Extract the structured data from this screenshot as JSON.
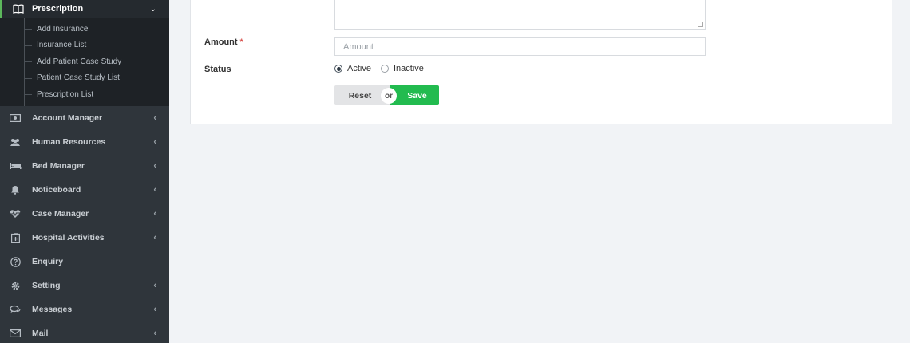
{
  "sidebar": {
    "open_menu": {
      "label": "Prescription",
      "icon": "book-icon"
    },
    "submenu": [
      "Add Insurance",
      "Insurance List",
      "Add Patient Case Study",
      "Patient Case Study List",
      "Prescription List"
    ],
    "items": [
      {
        "label": "Account Manager",
        "icon": "money-icon",
        "has_arrow": true
      },
      {
        "label": "Human Resources",
        "icon": "users-icon",
        "has_arrow": true
      },
      {
        "label": "Bed Manager",
        "icon": "bed-icon",
        "has_arrow": true
      },
      {
        "label": "Noticeboard",
        "icon": "bell-icon",
        "has_arrow": true
      },
      {
        "label": "Case Manager",
        "icon": "heartbeat-icon",
        "has_arrow": true
      },
      {
        "label": "Hospital Activities",
        "icon": "clipboard-icon",
        "has_arrow": true
      },
      {
        "label": "Enquiry",
        "icon": "question-icon",
        "has_arrow": false
      },
      {
        "label": "Setting",
        "icon": "gear-icon",
        "has_arrow": true
      },
      {
        "label": "Messages",
        "icon": "comments-icon",
        "has_arrow": true
      },
      {
        "label": "Mail",
        "icon": "envelope-icon",
        "has_arrow": true
      }
    ]
  },
  "form": {
    "amount_label": "Amount",
    "required_mark": "*",
    "amount_placeholder": "Amount",
    "amount_value": "",
    "status_label": "Status",
    "status_options": [
      "Active",
      "Inactive"
    ],
    "status_selected": "Active",
    "reset_label": "Reset",
    "or_label": "or",
    "save_label": "Save"
  },
  "colors": {
    "sidebar_bg": "#2f353b",
    "active_border": "#5cb85c",
    "save_button": "#22bb4f",
    "required": "#d9534f"
  }
}
